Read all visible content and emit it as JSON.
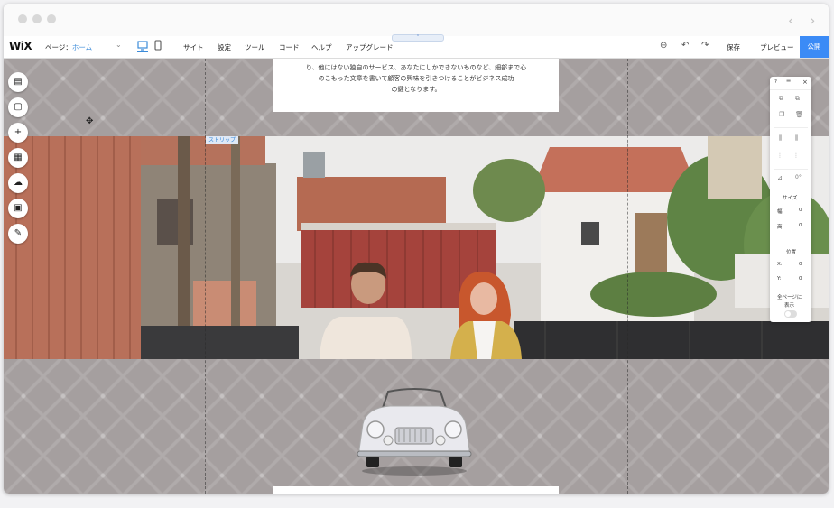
{
  "titlebar": {
    "back_arrow": "‹",
    "forward_arrow": "›"
  },
  "topbar": {
    "logo": "WiX",
    "page_label": "ページ：",
    "page_value": "ホーム",
    "menu": [
      "サイト",
      "設定",
      "ツール",
      "コード",
      "ヘルプ",
      "アップグレード"
    ],
    "save": "保存",
    "preview": "プレビュー",
    "publish": "公開"
  },
  "canvas": {
    "text_lines": [
      "り、他にはない独自のサービス、あなたにしかできないものなど、細部まで心",
      "のこもった文章を書いて顧客の興味を引きつけることがビジネス成功",
      "の鍵となります。"
    ],
    "strip_tag": "ストリップ"
  },
  "left_toolbar": {
    "tools": [
      {
        "name": "pages",
        "glyph": "▤"
      },
      {
        "name": "background",
        "glyph": "▢"
      },
      {
        "name": "add",
        "glyph": "+"
      },
      {
        "name": "apps",
        "glyph": "▦"
      },
      {
        "name": "upload",
        "glyph": "☁"
      },
      {
        "name": "market",
        "glyph": "▣"
      },
      {
        "name": "blog",
        "glyph": "✎"
      }
    ]
  },
  "right_panel": {
    "help": "?",
    "close": "×",
    "size_label": "サイズ",
    "width_label": "幅:",
    "width_value": "0",
    "height_label": "高:",
    "height_value": "0",
    "position_label": "位置",
    "x_label": "X:",
    "x_value": "0",
    "y_label": "Y:",
    "y_value": "0",
    "show_all_pages": "全ページに",
    "show_all_pages_2": "表示"
  },
  "colors": {
    "accent": "#3b8bf6",
    "canvas_bg": "#a59f9f",
    "link": "#3b8bd9"
  }
}
